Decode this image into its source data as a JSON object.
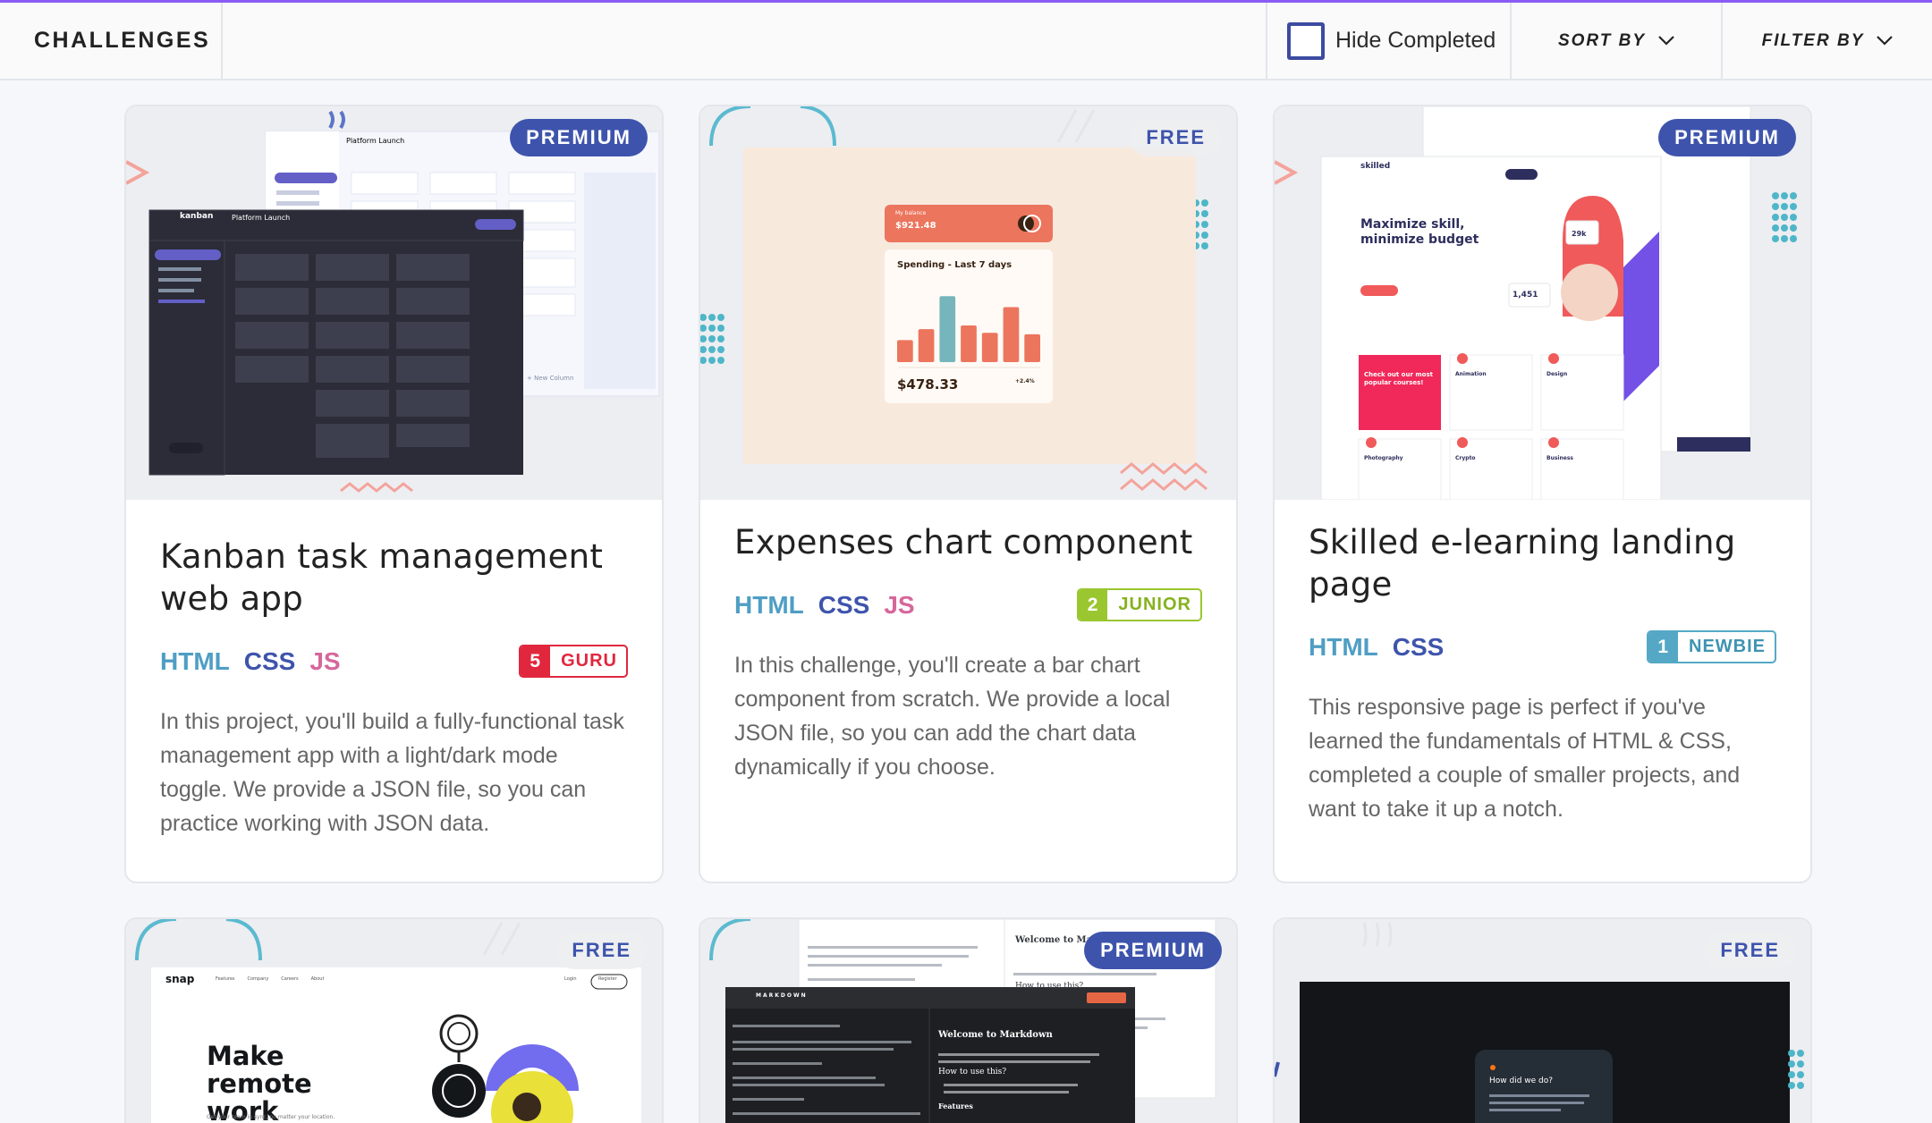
{
  "header": {
    "title": "CHALLENGES",
    "hide_completed": "Hide Completed",
    "sort_by": "SORT BY",
    "filter_by": "FILTER BY"
  },
  "colors": {
    "accent": "#3e54ac",
    "html": "#4f9ec4",
    "css": "#3e54ac",
    "js": "#d6679c",
    "guru": "#e0273e",
    "junior": "#9ac630",
    "newbie": "#55a8c5"
  },
  "cards": [
    {
      "badge": "PREMIUM",
      "title": "Kanban task management web app",
      "langs": [
        "HTML",
        "CSS",
        "JS"
      ],
      "level_num": "5",
      "level": "GURU",
      "description": "In this project, you'll build a fully-functional task management app with a light/dark mode toggle. We provide a JSON file, so you can practice working with JSON data.",
      "preview": {
        "app": "kanban",
        "board": "Platform Launch",
        "new_column": "+ New Column"
      }
    },
    {
      "badge": "FREE",
      "title": "Expenses chart component",
      "langs": [
        "HTML",
        "CSS",
        "JS"
      ],
      "level_num": "2",
      "level": "JUNIOR",
      "description": "In this challenge, you'll create a bar chart component from scratch. We provide a local JSON file, so you can add the chart data dynamically if you choose.",
      "preview": {
        "balance_label": "My balance",
        "balance": "$921.48",
        "spending_title": "Spending - Last 7 days",
        "total": "$478.33",
        "change": "+2.4%",
        "bars": [
          0.3,
          0.45,
          0.9,
          0.5,
          0.4,
          0.75,
          0.38
        ]
      }
    },
    {
      "badge": "PREMIUM",
      "title": "Skilled e-learning landing page",
      "langs": [
        "HTML",
        "CSS"
      ],
      "level_num": "1",
      "level": "NEWBIE",
      "description": "This responsive page is perfect if you've learned the fundamentals of HTML & CSS, completed a couple of smaller projects, and want to take it up a notch.",
      "preview": {
        "brand": "skilled",
        "headline": "Maximize skill, minimize budget",
        "stat_a": "1,451",
        "stat_b": "29k",
        "promo": "Check out our most popular courses!",
        "courses": [
          "Animation",
          "Design",
          "Photography",
          "Crypto",
          "Business"
        ]
      }
    },
    {
      "badge": "FREE",
      "preview": {
        "brand": "snap",
        "nav": [
          "Features",
          "Company",
          "Careers",
          "About"
        ],
        "login": "Login",
        "register": "Register",
        "headline": "Make remote work",
        "sub": "Get your team in sync, no matter your location."
      }
    },
    {
      "badge": "PREMIUM",
      "preview": {
        "brand": "MARKDOWN",
        "doc_title": "Welcome to Markdown",
        "section": "How to use this?",
        "features": "Features"
      }
    },
    {
      "badge": "FREE",
      "preview": {
        "question": "How did we do?"
      }
    }
  ]
}
